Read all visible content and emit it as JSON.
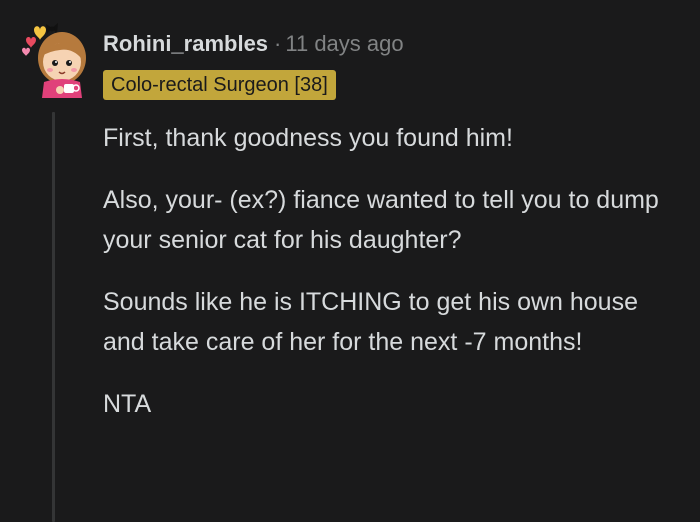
{
  "comment": {
    "author": "Rohini_rambles",
    "separator": "·",
    "timestamp": "11 days ago",
    "flair": "Colo-rectal Surgeon [38]",
    "paragraphs": [
      "First, thank goodness you found him!",
      "Also, your- (ex?) fiance wanted to tell you to dump your senior cat for his daughter?",
      "Sounds like he is ITCHING to get his own house and take care of her for the next -7 months!",
      "NTA"
    ]
  },
  "colors": {
    "background": "#1a1a1b",
    "text": "#d7dadc",
    "muted": "#818384",
    "flair_bg": "#c2a63b",
    "thread_line": "#343536"
  },
  "icons": {
    "avatar": "avatar-icon"
  }
}
